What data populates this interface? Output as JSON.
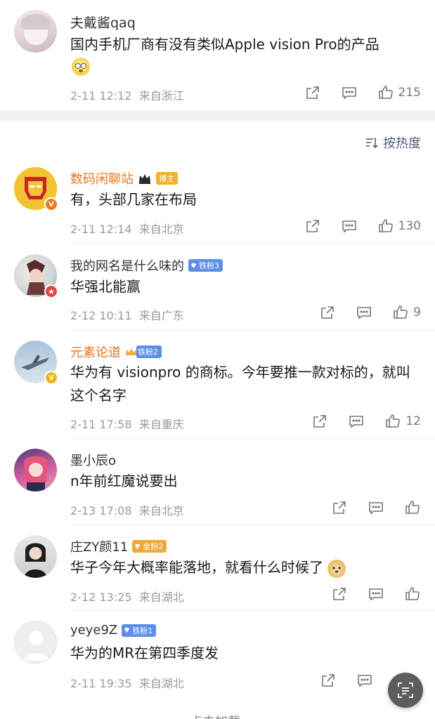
{
  "post": {
    "user": "夫戴酱qaq",
    "text": "国内手机厂商有没有类似Apple vision Pro的产品",
    "emoji": "dizzy-face-emoji",
    "time": "2-11 12:12",
    "location": "来自浙江",
    "likes": "215"
  },
  "sort": {
    "label": "按热度"
  },
  "comments": [
    {
      "user": "数码闲聊站",
      "badge": "博主",
      "badge_color": "#f0b12b",
      "verified": "orange-v",
      "text": "有，头部几家在布局",
      "time": "2-11 12:14",
      "location": "来自北京",
      "likes": "130"
    },
    {
      "user": "我的网名是什么味的",
      "badge": "铁粉3",
      "badge_color": "#5d8fe8",
      "verified": "red-star",
      "text": "华强北能赢",
      "time": "2-12 10:11",
      "location": "来自广东",
      "likes": "9"
    },
    {
      "user": "元素论道",
      "badge": "铁粉2",
      "badge_color": "#5d8fe8",
      "verified": "gold-v",
      "text": "华为有 visionpro 的商标。今年要推一款对标的，就叫这个名字",
      "time": "2-11 17:58",
      "location": "来自重庆",
      "likes": "12"
    },
    {
      "user": "墨小辰o",
      "text": "n年前红魔说要出",
      "time": "2-13 17:08",
      "location": "来自北京"
    },
    {
      "user": "庄ZY颜11",
      "badge": "金粉2",
      "badge_color": "#f0a93b",
      "text": "华子今年大概率能落地，就看什么时候了",
      "emoji": "doge-emoji",
      "time": "2-12 13:25",
      "location": "来自湖北"
    },
    {
      "user": "yeye9Z",
      "badge": "铁粉1",
      "badge_color": "#5d8fe8",
      "text": "华为的MR在第四季度发",
      "time": "2-11 19:35",
      "location": "来自湖北"
    }
  ],
  "footer": {
    "cutoff_text": "点击加载"
  }
}
